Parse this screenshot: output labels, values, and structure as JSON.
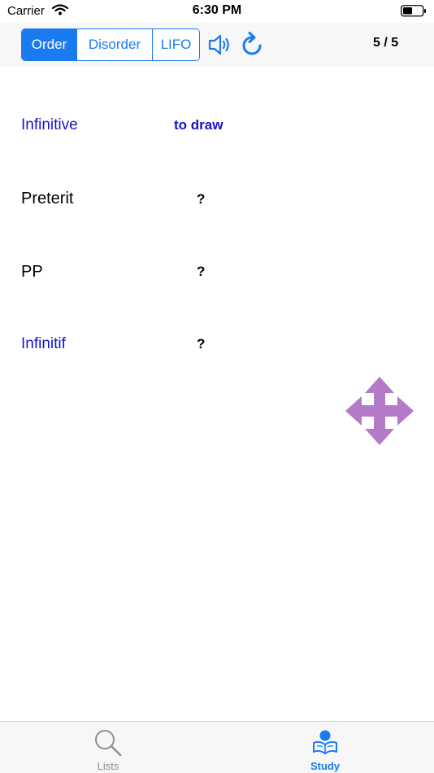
{
  "status_bar": {
    "carrier": "Carrier",
    "time": "6:30 PM"
  },
  "toolbar": {
    "modes": [
      "Order",
      "Disorder",
      "LIFO"
    ],
    "selected_mode": "Order",
    "counter": "5 / 5"
  },
  "rows": [
    {
      "label": "Infinitive",
      "value": "to draw",
      "color": "#1414cc"
    },
    {
      "label": "Preterit",
      "value": "?",
      "color": "#000000"
    },
    {
      "label": "PP",
      "value": "?",
      "color": "#000000"
    },
    {
      "label": "Infinitif",
      "value": "?",
      "color": "#1414cc"
    }
  ],
  "icons": {
    "speaker": "speaker-icon",
    "refresh": "refresh-icon",
    "move": "move-arrows-icon",
    "move_color": "#b57ac7"
  },
  "tab_bar": {
    "tabs": [
      {
        "label": "Lists",
        "icon": "search-icon",
        "selected": false
      },
      {
        "label": "Study",
        "icon": "reading-person-icon",
        "selected": true
      }
    ]
  }
}
